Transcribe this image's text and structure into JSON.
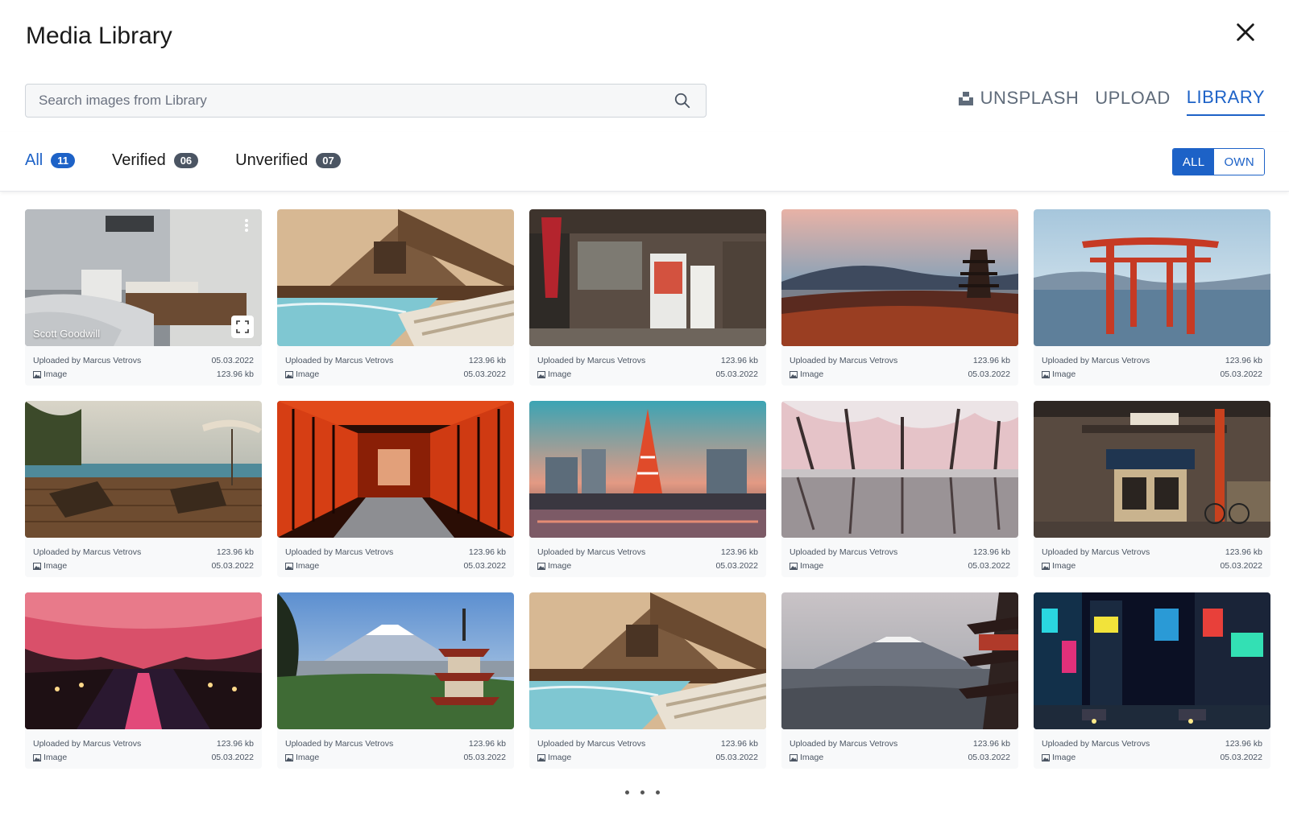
{
  "header": {
    "title": "Media Library"
  },
  "search": {
    "placeholder": "Search images from Library"
  },
  "source_tabs": [
    {
      "label": "UNSPLASH",
      "icon": "unsplash-icon"
    },
    {
      "label": "UPLOAD"
    },
    {
      "label": "LIBRARY",
      "active": true
    }
  ],
  "filters": [
    {
      "label": "All",
      "count": "11",
      "active": true
    },
    {
      "label": "Verified",
      "count": "06"
    },
    {
      "label": "Unverified",
      "count": "07"
    }
  ],
  "ownership": {
    "all": "ALL",
    "own": "OWN"
  },
  "cards": [
    {
      "scene": "bedroom",
      "overlay": "Scott Goodwill",
      "uploader": "Uploaded by Marcus Vetrovs",
      "type": "Image",
      "top_right": "05.03.2022",
      "bottom_right": "123.96 kb"
    },
    {
      "scene": "resort-pool",
      "uploader": "Uploaded by Marcus Vetrovs",
      "type": "Image",
      "top_right": "123.96 kb",
      "bottom_right": "05.03.2022"
    },
    {
      "scene": "street-shop",
      "uploader": "Uploaded by Marcus Vetrovs",
      "type": "Image",
      "top_right": "123.96 kb",
      "bottom_right": "05.03.2022"
    },
    {
      "scene": "pagoda-dusk",
      "uploader": "Uploaded by Marcus Vetrovs",
      "type": "Image",
      "top_right": "123.96 kb",
      "bottom_right": "05.03.2022"
    },
    {
      "scene": "torii-water",
      "uploader": "Uploaded by Marcus Vetrovs",
      "type": "Image",
      "top_right": "123.96 kb",
      "bottom_right": "05.03.2022"
    },
    {
      "scene": "ocean-deck",
      "uploader": "Uploaded by Marcus Vetrovs",
      "type": "Image",
      "top_right": "123.96 kb",
      "bottom_right": "05.03.2022"
    },
    {
      "scene": "torii-tunnel",
      "uploader": "Uploaded by Marcus Vetrovs",
      "type": "Image",
      "top_right": "123.96 kb",
      "bottom_right": "05.03.2022"
    },
    {
      "scene": "tokyo-tower",
      "uploader": "Uploaded by Marcus Vetrovs",
      "type": "Image",
      "top_right": "123.96 kb",
      "bottom_right": "05.03.2022"
    },
    {
      "scene": "cherry-trees",
      "uploader": "Uploaded by Marcus Vetrovs",
      "type": "Image",
      "top_right": "123.96 kb",
      "bottom_right": "05.03.2022"
    },
    {
      "scene": "storefront",
      "uploader": "Uploaded by Marcus Vetrovs",
      "type": "Image",
      "top_right": "123.96 kb",
      "bottom_right": "05.03.2022"
    },
    {
      "scene": "sakura-canal",
      "uploader": "Uploaded by Marcus Vetrovs",
      "type": "Image",
      "top_right": "123.96 kb",
      "bottom_right": "05.03.2022"
    },
    {
      "scene": "fuji-pagoda",
      "uploader": "Uploaded by Marcus Vetrovs",
      "type": "Image",
      "top_right": "123.96 kb",
      "bottom_right": "05.03.2022"
    },
    {
      "scene": "resort-pool",
      "uploader": "Uploaded by Marcus Vetrovs",
      "type": "Image",
      "top_right": "123.96 kb",
      "bottom_right": "05.03.2022"
    },
    {
      "scene": "fuji-city",
      "uploader": "Uploaded by Marcus Vetrovs",
      "type": "Image",
      "top_right": "123.96 kb",
      "bottom_right": "05.03.2022"
    },
    {
      "scene": "neon-street",
      "uploader": "Uploaded by Marcus Vetrovs",
      "type": "Image",
      "top_right": "123.96 kb",
      "bottom_right": "05.03.2022"
    }
  ],
  "colors": {
    "accent": "#1d62c7",
    "badge": "#4b5563"
  }
}
